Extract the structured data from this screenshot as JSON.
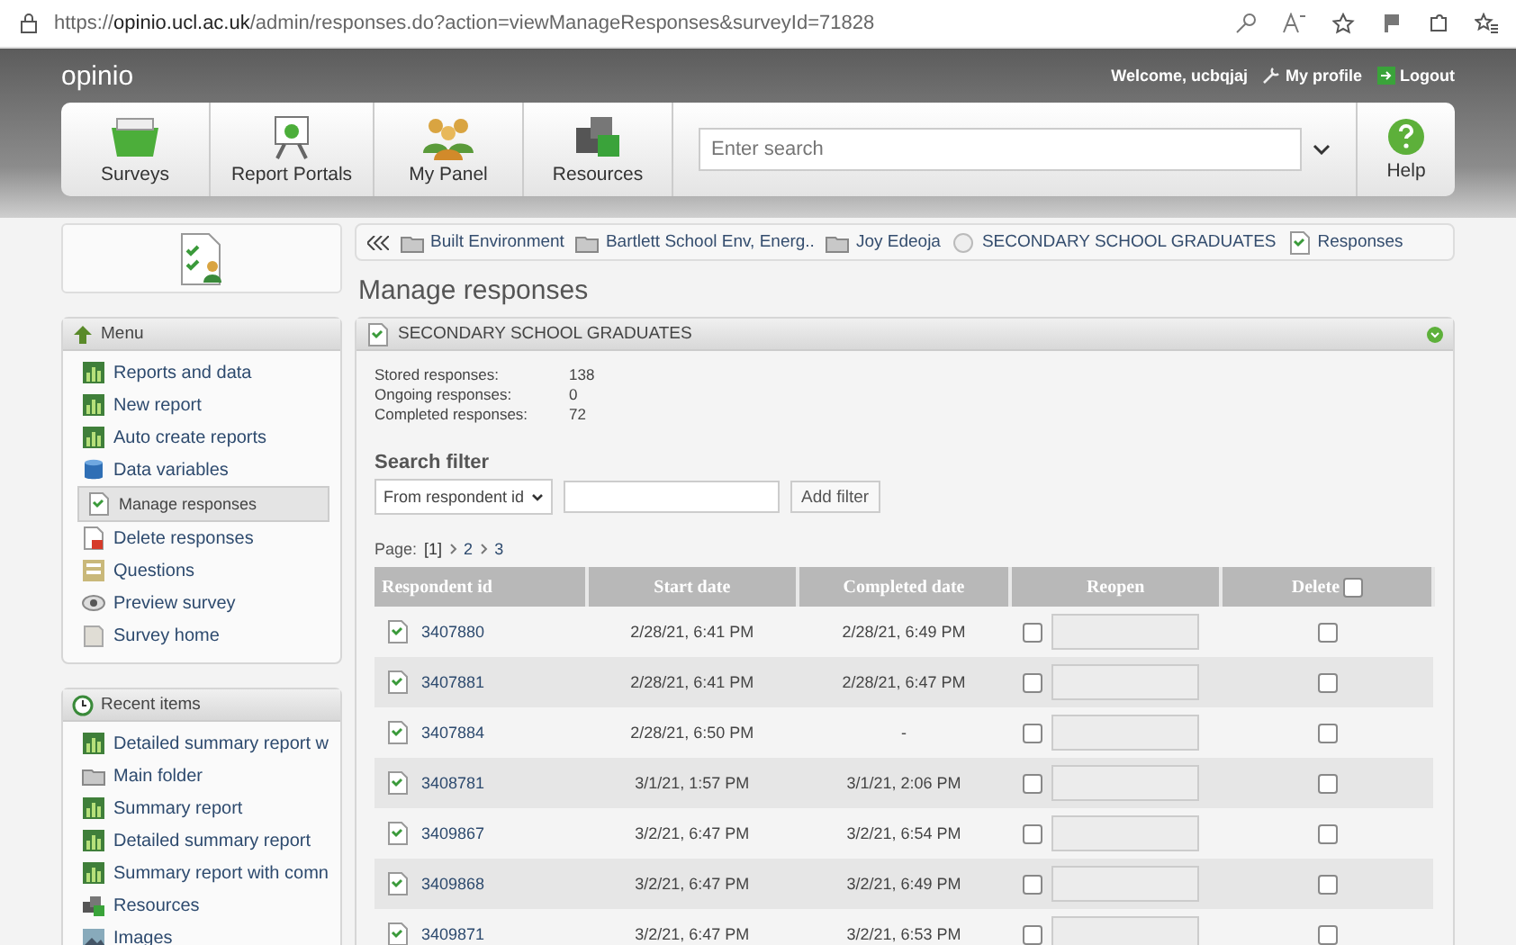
{
  "browser": {
    "url": "https://**opinio.ucl.ac.uk**/admin/responses.do?action=viewManageResponses&surveyId=71828"
  },
  "header": {
    "app_name": "opinio",
    "welcome": "Welcome, ucbqjaj",
    "profile_link": "My profile",
    "logout_link": "Logout"
  },
  "toolbar": {
    "items": [
      {
        "label": "Surveys",
        "kind": "surveys"
      },
      {
        "label": "Report Portals",
        "kind": "portals"
      },
      {
        "label": "My Panel",
        "kind": "panel"
      },
      {
        "label": "Resources",
        "kind": "resources"
      }
    ],
    "search": {
      "placeholder": "Enter search"
    },
    "help": "Help"
  },
  "breadcrumb": [
    {
      "label": "Built Environment",
      "kind": "folder"
    },
    {
      "label": "Bartlett School Env, Energ..",
      "kind": "folder"
    },
    {
      "label": "Joy Edeoja",
      "kind": "folder"
    },
    {
      "label": "SECONDARY SCHOOL GRADUATES",
      "kind": "survey"
    },
    {
      "label": "Responses",
      "kind": "doc"
    }
  ],
  "page_title": "Manage responses",
  "menu": {
    "title": "Menu",
    "items": [
      {
        "label": "Reports and data",
        "kind": "chart",
        "selected": false
      },
      {
        "label": "New report",
        "kind": "chart",
        "selected": false
      },
      {
        "label": "Auto create reports",
        "kind": "chart",
        "selected": false
      },
      {
        "label": "Data variables",
        "kind": "db",
        "selected": false
      },
      {
        "label": "Manage responses",
        "kind": "doc",
        "selected": true
      },
      {
        "label": "Delete responses",
        "kind": "docdel",
        "selected": false
      },
      {
        "label": "Questions",
        "kind": "list",
        "selected": false
      },
      {
        "label": "Preview survey",
        "kind": "eye",
        "selected": false
      },
      {
        "label": "Survey home",
        "kind": "home",
        "selected": false
      }
    ]
  },
  "recent": {
    "title": "Recent items",
    "items": [
      {
        "label": "Detailed summary report w",
        "kind": "chart"
      },
      {
        "label": "Main folder",
        "kind": "folder"
      },
      {
        "label": "Summary report",
        "kind": "chart"
      },
      {
        "label": "Detailed summary report",
        "kind": "chart"
      },
      {
        "label": "Summary report with comn",
        "kind": "chart"
      },
      {
        "label": "Resources",
        "kind": "resources"
      },
      {
        "label": "Images",
        "kind": "image"
      }
    ]
  },
  "panel": {
    "title": "SECONDARY SCHOOL GRADUATES",
    "stats": [
      {
        "label": "Stored responses:",
        "value": "138"
      },
      {
        "label": "Ongoing responses:",
        "value": "0"
      },
      {
        "label": "Completed responses:",
        "value": "72"
      }
    ],
    "filter": {
      "label": "Search filter",
      "select": "From respondent id",
      "button": "Add filter"
    },
    "pagination": {
      "label": "Page:",
      "pages": [
        {
          "label": "[1]",
          "selected": true
        },
        {
          "label": "2",
          "selected": false
        },
        {
          "label": "3",
          "selected": false
        }
      ]
    },
    "table": {
      "columns": [
        "Respondent id",
        "Start date",
        "Completed date",
        "Reopen",
        "Delete"
      ],
      "delete_all_checked": false,
      "rows": [
        {
          "id": "3407880",
          "start": "2/28/21, 6:41 PM",
          "completed": "2/28/21, 6:49 PM",
          "reopen_checked": false,
          "delete_checked": false
        },
        {
          "id": "3407881",
          "start": "2/28/21, 6:41 PM",
          "completed": "2/28/21, 6:47 PM",
          "reopen_checked": false,
          "delete_checked": false
        },
        {
          "id": "3407884",
          "start": "2/28/21, 6:50 PM",
          "completed": "-",
          "reopen_checked": false,
          "delete_checked": false
        },
        {
          "id": "3408781",
          "start": "3/1/21, 1:57 PM",
          "completed": "3/1/21, 2:06 PM",
          "reopen_checked": false,
          "delete_checked": false
        },
        {
          "id": "3409867",
          "start": "3/2/21, 6:47 PM",
          "completed": "3/2/21, 6:54 PM",
          "reopen_checked": false,
          "delete_checked": false
        },
        {
          "id": "3409868",
          "start": "3/2/21, 6:47 PM",
          "completed": "3/2/21, 6:49 PM",
          "reopen_checked": false,
          "delete_checked": false
        },
        {
          "id": "3409871",
          "start": "3/2/21, 6:47 PM",
          "completed": "3/2/21, 6:53 PM",
          "reopen_checked": false,
          "delete_checked": false
        }
      ]
    }
  }
}
